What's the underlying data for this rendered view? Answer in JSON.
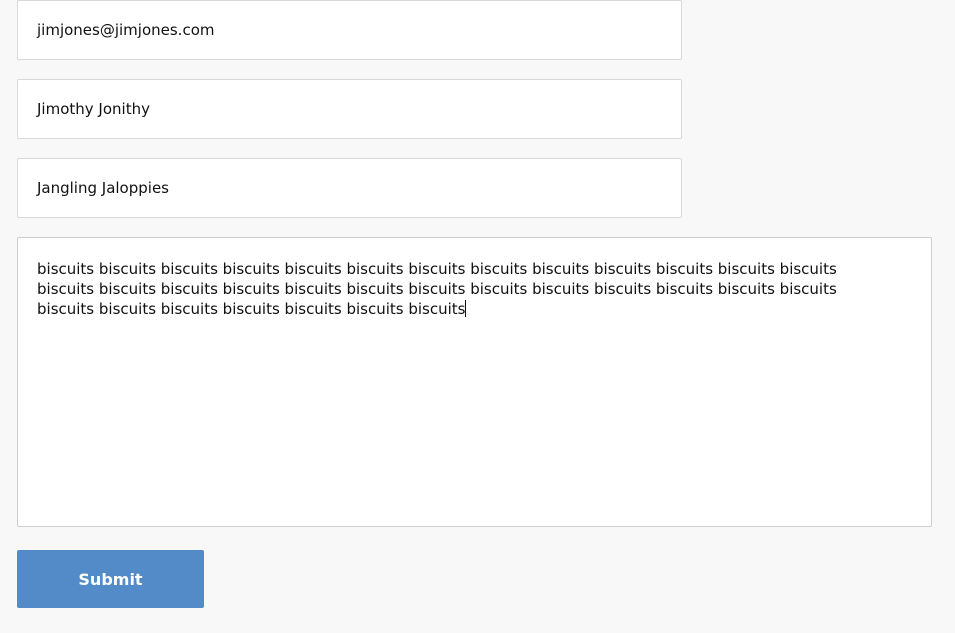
{
  "form": {
    "email_value": "jimjones@jimjones.com",
    "name_value": "Jimothy Jonithy",
    "company_value": "Jangling Jaloppies",
    "message_value": "biscuits biscuits biscuits biscuits biscuits biscuits biscuits biscuits biscuits biscuits biscuits biscuits biscuits biscuits biscuits biscuits biscuits biscuits biscuits biscuits biscuits biscuits biscuits biscuits biscuits biscuits biscuits biscuits biscuits biscuits biscuits biscuits biscuits",
    "submit_label": "Submit"
  },
  "colors": {
    "page_background": "#f8f8f8",
    "field_background": "#ffffff",
    "submit_background": "#538bc9",
    "submit_text": "#ffffff"
  }
}
